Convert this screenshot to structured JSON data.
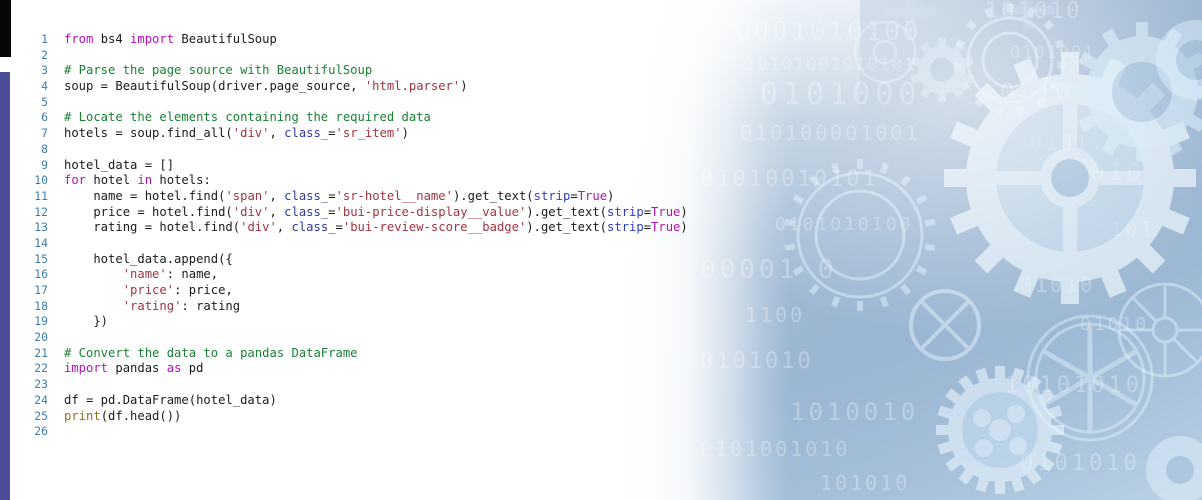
{
  "page": {
    "language": "Python",
    "theme_background": "#ffffff",
    "accent_bar_black": "#070707",
    "accent_bar_purple": "#4b4d99",
    "artwork_theme": "blue gears and binary digits",
    "artwork_colors": {
      "blue_dark": "#6a8fb5",
      "blue_mid": "#8fa9c4",
      "blue_light": "#cfe0ee",
      "gear_light": "#e3f2fb"
    }
  },
  "syntax_colors": {
    "keyword": "#b712b7",
    "comment": "#1a8033",
    "string": "#a23540",
    "function": "#8a7420",
    "parameter": "#2f3fc4",
    "attribute": "#2b3b9e",
    "plain": "#1b1b1b",
    "line_number": "#3f7cae"
  },
  "code": {
    "line_numbers": [
      1,
      2,
      3,
      4,
      5,
      6,
      7,
      8,
      9,
      10,
      11,
      12,
      13,
      14,
      15,
      16,
      17,
      18,
      19,
      20,
      21,
      22,
      23,
      24,
      25,
      26
    ],
    "plain_text": [
      "from bs4 import BeautifulSoup",
      "",
      "# Parse the page source with BeautifulSoup",
      "soup = BeautifulSoup(driver.page_source, 'html.parser')",
      "",
      "# Locate the elements containing the required data",
      "hotels = soup.find_all('div', class_='sr_item')",
      "",
      "hotel_data = []",
      "for hotel in hotels:",
      "    name = hotel.find('span', class_='sr-hotel__name').get_text(strip=True)",
      "    price = hotel.find('div', class_='bui-price-display__value').get_text(strip=True)",
      "    rating = hotel.find('div', class_='bui-review-score__badge').get_text(strip=True)",
      "",
      "    hotel_data.append({",
      "        'name': name,",
      "        'price': price,",
      "        'rating': rating",
      "    })",
      "",
      "# Convert the data to a pandas DataFrame",
      "import pandas as pd",
      "",
      "df = pd.DataFrame(hotel_data)",
      "print(df.head())",
      ""
    ],
    "lines": [
      {
        "n": 1,
        "tokens": [
          {
            "t": "from",
            "c": "kw"
          },
          {
            "t": " bs4 ",
            "c": "pl"
          },
          {
            "t": "import",
            "c": "kw"
          },
          {
            "t": " BeautifulSoup",
            "c": "pl"
          }
        ]
      },
      {
        "n": 2,
        "tokens": []
      },
      {
        "n": 3,
        "tokens": [
          {
            "t": "# Parse the page source with BeautifulSoup",
            "c": "com"
          }
        ]
      },
      {
        "n": 4,
        "tokens": [
          {
            "t": "soup = BeautifulSoup(driver.page_source, ",
            "c": "pl"
          },
          {
            "t": "'html.parser'",
            "c": "str"
          },
          {
            "t": ")",
            "c": "pl"
          }
        ]
      },
      {
        "n": 5,
        "tokens": []
      },
      {
        "n": 6,
        "tokens": [
          {
            "t": "# Locate the elements containing the required data",
            "c": "com"
          }
        ]
      },
      {
        "n": 7,
        "tokens": [
          {
            "t": "hotels = soup.find_all(",
            "c": "pl"
          },
          {
            "t": "'div'",
            "c": "str"
          },
          {
            "t": ", ",
            "c": "pl"
          },
          {
            "t": "class_",
            "c": "cls"
          },
          {
            "t": "=",
            "c": "pl"
          },
          {
            "t": "'sr_item'",
            "c": "str"
          },
          {
            "t": ")",
            "c": "pl"
          }
        ]
      },
      {
        "n": 8,
        "tokens": []
      },
      {
        "n": 9,
        "tokens": [
          {
            "t": "hotel_data = []",
            "c": "pl"
          }
        ]
      },
      {
        "n": 10,
        "tokens": [
          {
            "t": "for",
            "c": "kw"
          },
          {
            "t": " hotel ",
            "c": "pl"
          },
          {
            "t": "in",
            "c": "kw"
          },
          {
            "t": " hotels:",
            "c": "pl"
          }
        ]
      },
      {
        "n": 11,
        "tokens": [
          {
            "t": "    name = hotel.find(",
            "c": "pl"
          },
          {
            "t": "'span'",
            "c": "str"
          },
          {
            "t": ", ",
            "c": "pl"
          },
          {
            "t": "class_",
            "c": "cls"
          },
          {
            "t": "=",
            "c": "pl"
          },
          {
            "t": "'sr-hotel__name'",
            "c": "str"
          },
          {
            "t": ").get_text(",
            "c": "pl"
          },
          {
            "t": "strip",
            "c": "par"
          },
          {
            "t": "=",
            "c": "pl"
          },
          {
            "t": "True",
            "c": "kw"
          },
          {
            "t": ")",
            "c": "pl"
          }
        ]
      },
      {
        "n": 12,
        "tokens": [
          {
            "t": "    price = hotel.find(",
            "c": "pl"
          },
          {
            "t": "'div'",
            "c": "str"
          },
          {
            "t": ", ",
            "c": "pl"
          },
          {
            "t": "class_",
            "c": "cls"
          },
          {
            "t": "=",
            "c": "pl"
          },
          {
            "t": "'bui-price-display__value'",
            "c": "str"
          },
          {
            "t": ").get_text(",
            "c": "pl"
          },
          {
            "t": "strip",
            "c": "par"
          },
          {
            "t": "=",
            "c": "pl"
          },
          {
            "t": "True",
            "c": "kw"
          },
          {
            "t": ")",
            "c": "pl"
          }
        ]
      },
      {
        "n": 13,
        "tokens": [
          {
            "t": "    rating = hotel.find(",
            "c": "pl"
          },
          {
            "t": "'div'",
            "c": "str"
          },
          {
            "t": ", ",
            "c": "pl"
          },
          {
            "t": "class_",
            "c": "cls"
          },
          {
            "t": "=",
            "c": "pl"
          },
          {
            "t": "'bui-review-score__badge'",
            "c": "str"
          },
          {
            "t": ").get_text(",
            "c": "pl"
          },
          {
            "t": "strip",
            "c": "par"
          },
          {
            "t": "=",
            "c": "pl"
          },
          {
            "t": "True",
            "c": "kw"
          },
          {
            "t": ")",
            "c": "pl"
          }
        ]
      },
      {
        "n": 14,
        "tokens": []
      },
      {
        "n": 15,
        "tokens": [
          {
            "t": "    hotel_data.append({",
            "c": "pl"
          }
        ]
      },
      {
        "n": 16,
        "tokens": [
          {
            "t": "        ",
            "c": "pl"
          },
          {
            "t": "'name'",
            "c": "str"
          },
          {
            "t": ": name,",
            "c": "pl"
          }
        ]
      },
      {
        "n": 17,
        "tokens": [
          {
            "t": "        ",
            "c": "pl"
          },
          {
            "t": "'price'",
            "c": "str"
          },
          {
            "t": ": price,",
            "c": "pl"
          }
        ]
      },
      {
        "n": 18,
        "tokens": [
          {
            "t": "        ",
            "c": "pl"
          },
          {
            "t": "'rating'",
            "c": "str"
          },
          {
            "t": ": rating",
            "c": "pl"
          }
        ]
      },
      {
        "n": 19,
        "tokens": [
          {
            "t": "    })",
            "c": "pl"
          }
        ]
      },
      {
        "n": 20,
        "tokens": []
      },
      {
        "n": 21,
        "tokens": [
          {
            "t": "# Convert the data to a pandas DataFrame",
            "c": "com"
          }
        ]
      },
      {
        "n": 22,
        "tokens": [
          {
            "t": "import",
            "c": "kw"
          },
          {
            "t": " pandas ",
            "c": "pl"
          },
          {
            "t": "as",
            "c": "kw"
          },
          {
            "t": " pd",
            "c": "pl"
          }
        ]
      },
      {
        "n": 23,
        "tokens": []
      },
      {
        "n": 24,
        "tokens": [
          {
            "t": "df = pd.DataFrame(hotel_data)",
            "c": "pl"
          }
        ]
      },
      {
        "n": 25,
        "tokens": [
          {
            "t": "print",
            "c": "fn"
          },
          {
            "t": "(df.head())",
            "c": "pl"
          }
        ]
      },
      {
        "n": 26,
        "tokens": []
      }
    ]
  },
  "artwork": {
    "binary_strings": [
      "0001010100",
      "101010010101",
      "0101000010",
      "01010001010",
      "010100001001",
      "0101010100",
      "010010100",
      "1010101010",
      "01010010101",
      "10101010",
      "0101000",
      "101010010",
      "0101010",
      "10100101",
      "010101",
      "1010100101",
      "01010101",
      "001010",
      "10101",
      "0101"
    ]
  }
}
